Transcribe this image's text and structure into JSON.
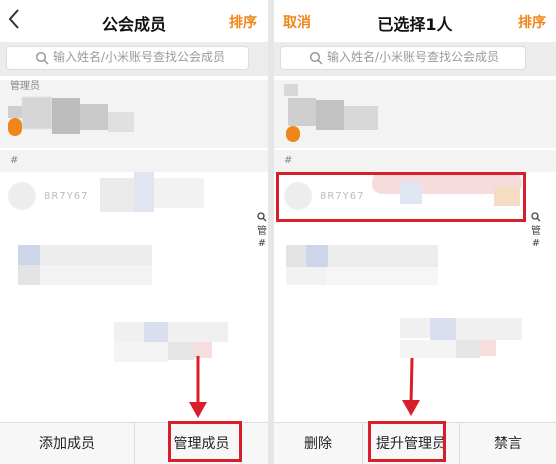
{
  "left": {
    "title": "公会成员",
    "sort_label": "排序",
    "search_placeholder": "输入姓名/小米账号查找公会成员",
    "section_admin": "管理员",
    "section_hash": "#",
    "member_id": "8R7Y67",
    "side_index": [
      "管",
      "#"
    ],
    "bottom": {
      "add_label": "添加成员",
      "manage_label": "管理成员"
    }
  },
  "right": {
    "cancel_label": "取消",
    "title": "已选择1人",
    "sort_label": "排序",
    "search_placeholder": "输入姓名/小米账号查找公会成员",
    "section_hash": "#",
    "member_id": "8R7Y67",
    "side_index": [
      "管",
      "#"
    ],
    "bottom": {
      "delete_label": "删除",
      "promote_label": "提升管理员",
      "mute_label": "禁言"
    }
  },
  "colors": {
    "accent": "#f08519",
    "highlight": "#d81e2a"
  }
}
